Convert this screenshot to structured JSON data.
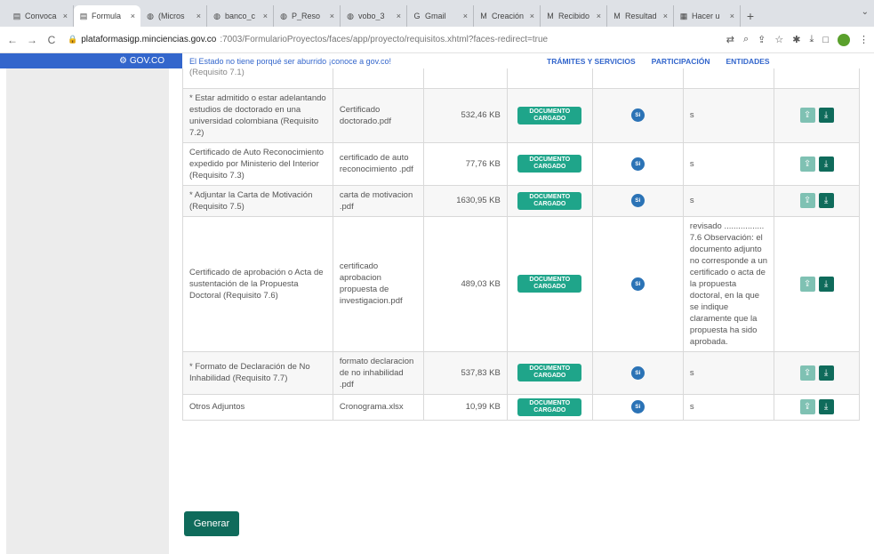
{
  "browser": {
    "tabs": [
      {
        "label": "Convoca",
        "icon": "doc-icon"
      },
      {
        "label": "Formula",
        "icon": "doc-icon",
        "active": true
      },
      {
        "label": "(Micros",
        "icon": "globe-icon"
      },
      {
        "label": "banco_c",
        "icon": "globe-icon"
      },
      {
        "label": "P_Reso",
        "icon": "globe-icon"
      },
      {
        "label": "vobo_3",
        "icon": "globe-icon"
      },
      {
        "label": "Gmail",
        "icon": "google-icon"
      },
      {
        "label": "Creación",
        "icon": "gmail-icon"
      },
      {
        "label": "Recibido",
        "icon": "gmail-icon"
      },
      {
        "label": "Resultad",
        "icon": "gmail-icon"
      },
      {
        "label": "Hacer u",
        "icon": "table-icon"
      }
    ],
    "url_host": "plataformasigp.minciencias.gov.co",
    "url_path": ":7003/FormularioProyectos/faces/app/proyecto/requisitos.xhtml?faces-redirect=true"
  },
  "govbar": {
    "logo": "GOV.CO",
    "message": "El Estado no tiene porqué ser aburrido ¡conoce a gov.co!",
    "nav": [
      "TRÁMITES Y SERVICIOS",
      "PARTICIPACIÓN",
      "ENTIDADES"
    ]
  },
  "table": {
    "partial_top_label": "(Requisito 7.1)",
    "rows": [
      {
        "name": "* Estar admitido o estar adelantando estudios de doctorado en una universidad colombiana (Requisito 7.2)",
        "file": "Certificado doctorado.pdf",
        "size": "532,46 KB",
        "state": "DOCUMENTO CARGADO",
        "selection": "Si",
        "observation": "s"
      },
      {
        "name": "Certificado de Auto Reconocimiento expedido por Ministerio del Interior (Requisito 7.3)",
        "file": "certificado de auto reconocimiento .pdf",
        "size": "77,76 KB",
        "state": "DOCUMENTO CARGADO",
        "selection": "Si",
        "observation": "s"
      },
      {
        "name": "* Adjuntar la Carta de Motivación (Requisito 7.5)",
        "file": "carta de motivacion .pdf",
        "size": "1630,95 KB",
        "state": "DOCUMENTO CARGADO",
        "selection": "Si",
        "observation": "s"
      },
      {
        "name": "Certificado de aprobación o Acta de sustentación de la Propuesta Doctoral (Requisito 7.6)",
        "file": "certificado aprobacion propuesta de investigacion.pdf",
        "size": "489,03 KB",
        "state": "DOCUMENTO CARGADO",
        "selection": "Si",
        "observation": "revisado ................. 7.6 Observación: el documento adjunto no corresponde a un certificado o acta de la propuesta doctoral, en la que se indique claramente que la propuesta ha sido aprobada."
      },
      {
        "name": "* Formato de Declaración de No Inhabilidad (Requisito 7.7)",
        "file": "formato declaracion de no inhabilidad .pdf",
        "size": "537,83 KB",
        "state": "DOCUMENTO CARGADO",
        "selection": "Si",
        "observation": "s"
      },
      {
        "name": "Otros Adjuntos",
        "file": "Cronograma.xlsx",
        "size": "10,99 KB",
        "state": "DOCUMENTO CARGADO",
        "selection": "Si",
        "observation": "s"
      }
    ]
  },
  "generate_button": "Generar"
}
